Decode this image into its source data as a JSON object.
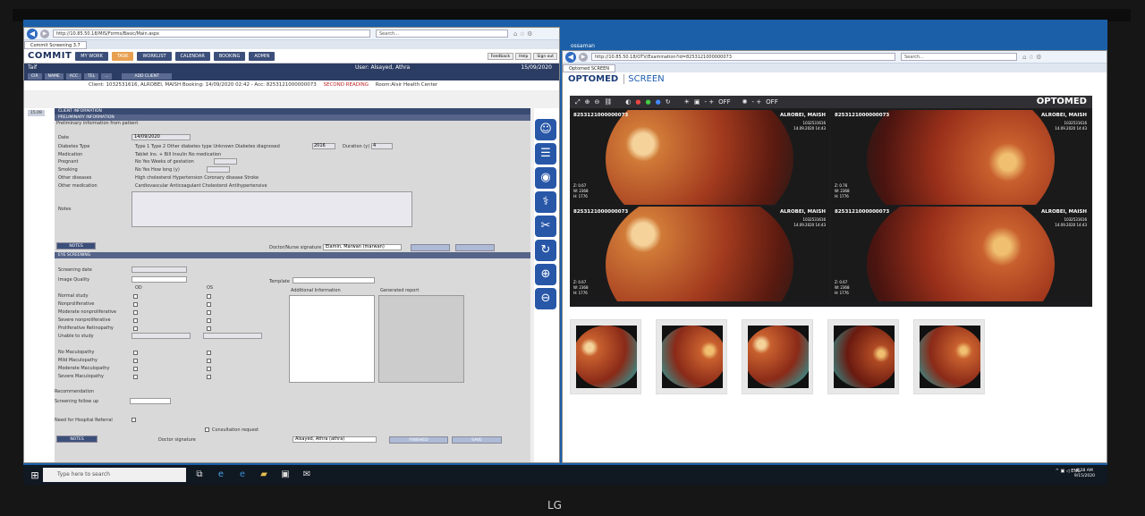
{
  "left_window": {
    "url": "http://10.85.50.18/MIS/Forms/Basic/Main.aspx",
    "search_placeholder": "Search...",
    "tab_title": "Commit Screening 3.7",
    "app_logo": "COMMIT",
    "menu": [
      "MY WORK",
      "TASK",
      "WORKLIST",
      "CALENDAR",
      "BOOKING",
      "ADMIN"
    ],
    "menu_right": [
      "Feedback",
      "Help",
      "Sign out"
    ],
    "user_left": "Taif",
    "user": "User: Alsayed, Athra",
    "date": "15/09/2020",
    "toolbar": [
      "CIR",
      "NAME",
      "ACC",
      "TEL",
      "...",
      "ADD CLIENT"
    ],
    "client": "Client: 1032531616, ALROBEI, MAISH Booking: 14/09/2020 02:42 - Acc: 8253121000000073",
    "second_reading": "SECOND READING",
    "room": "Room:Alsir Health Center",
    "side_label": "15.09",
    "sections": {
      "client_info": "CLIENT INFORMATION",
      "preliminary": "PRELIMINARY INFORMATION",
      "preliminary_desc": "Preliminary information from patient",
      "eye_screening": "EYE SCREENING"
    },
    "fields": {
      "date_label": "Date",
      "date_value": "14/09/2020",
      "diabetes_type": "Diabetes Type",
      "diabetes_opts": "Type 1   Type 2   Other diabetes type   Unknown   Diabetes diagnosed",
      "diagnosed_year": "2016",
      "duration_label": "Duration (y)",
      "duration_value": "4",
      "medication": "Medication",
      "medication_opts": "Tablet   Ins. + Bill   Insulin   No medication",
      "pregnant": "Pregnant",
      "pregnant_opts": "No   Yes  Weeks of gestation",
      "smoking": "Smoking",
      "smoking_opts": "No   Yes  How long (y)",
      "other_diseases": "Other diseases",
      "other_diseases_opts": "High cholesterol   Hypertension   Coronary disease   Stroke",
      "other_medication": "Other medication",
      "other_medication_opts": "Cardiovascular   Anticoagulant   Cholesterol   Antihypertensive",
      "notes": "Notes",
      "notes_btn": "NOTES",
      "doctor_nurse_sig": "Doctor/Nurse signature",
      "doctor_nurse_value": "Elamin, Marwan (marwan)",
      "screening_date": "Screening date",
      "image_quality": "Image Quality",
      "template": "Template",
      "od": "OD",
      "os": "OS",
      "additional_info": "Additional Information",
      "generated_report": "Generated report",
      "grading": [
        "Normal study",
        "Nonproliferative",
        "Moderate nonproliferative",
        "Severe nonproliferative",
        "Proliferative Retinopathy",
        "Unable to study"
      ],
      "maculo": [
        "No Maculopathy",
        "Mild Maculopathy",
        "Moderate Maculopathy",
        "Severe Maculopathy"
      ],
      "recommendation": "Recommendation",
      "followup": "Screening follow up",
      "referral": "Need for Hospital Referral",
      "consultation": "Consultation request",
      "doctor_sig": "Doctor signature",
      "doctor_sig_value": "Alsayed, Athra (athra)",
      "finished": "FINISHED",
      "save": "SAVE"
    }
  },
  "right_window": {
    "user_label": "ossaman",
    "url": "http://10.85.50.18/OTV/Examination?id=8253121000000073",
    "search_placeholder": "Search...",
    "tab_title": "Optomed SCREEN",
    "brand": "OPTOMED",
    "product": "SCREEN",
    "zoom_off_1": "OFF",
    "zoom_off_2": "OFF",
    "viewer_brand": "OPTOMED",
    "images": [
      {
        "id": "8253121000000073",
        "name": "ALROBEI, MAISH",
        "pid": "1032531616",
        "date": "14.09.2020 14:43",
        "z": "Z: 0.67",
        "w": "W: 2368",
        "h": "H: 1776"
      },
      {
        "id": "8253121000000073",
        "name": "ALROBEI, MAISH",
        "pid": "1032531616",
        "date": "14.09.2020 14:43",
        "z": "Z: 0.76",
        "w": "W: 2368",
        "h": "H: 1776"
      },
      {
        "id": "8253121000000073",
        "name": "ALROBEI, MAISH",
        "pid": "1032531616",
        "date": "14.09.2020 14:43",
        "z": "Z: 0.67",
        "w": "W: 2368",
        "h": "H: 1776"
      },
      {
        "id": "8253121000000073",
        "name": "ALROBEI, MAISH",
        "pid": "1032531616",
        "date": "14.09.2020 14:43",
        "z": "Z: 0.67",
        "w": "W: 2368",
        "h": "H: 1776"
      }
    ]
  },
  "taskbar": {
    "search_placeholder": "Type here to search",
    "lang": "ENG",
    "time": "8:38 AM",
    "date": "9/15/2020"
  },
  "monitor_brand": "LG"
}
